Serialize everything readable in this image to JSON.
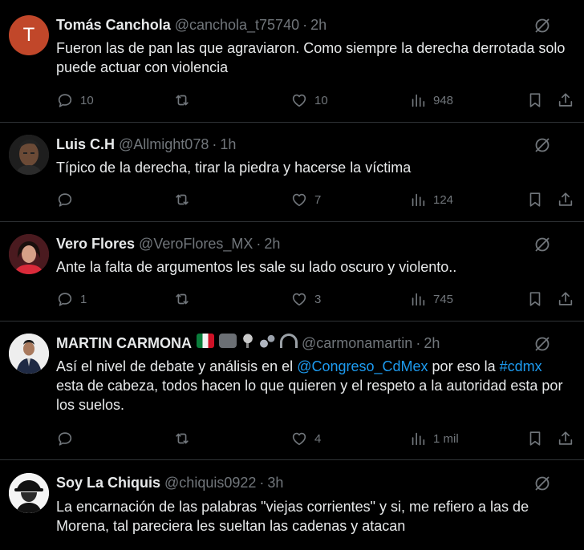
{
  "tweets": [
    {
      "name": "Tomás Canchola",
      "handle": "@canchola_t75740",
      "time": "2h",
      "avatar_letter": "T",
      "avatar_color": "#c1472a",
      "text": "Fueron las de pan las que agraviaron. Como siempre la derecha derrotada solo puede actuar con violencia",
      "replies": "10",
      "reposts": "",
      "likes": "10",
      "views": "948"
    },
    {
      "name": "Luis C.H",
      "handle": "@Allmight078",
      "time": "1h",
      "text": "Típico de la derecha, tirar la piedra y hacerse la víctima",
      "replies": "",
      "reposts": "",
      "likes": "7",
      "views": "124"
    },
    {
      "name": "Vero Flores",
      "handle": "@VeroFlores_MX",
      "time": "2h",
      "text": "Ante la falta de argumentos les sale su lado oscuro y violento..",
      "replies": "1",
      "reposts": "",
      "likes": "3",
      "views": "745"
    },
    {
      "name": "MARTIN CARMONA",
      "handle": "@carmonamartin",
      "time": "2h",
      "text_a": "Así el nivel de debate y análisis en el ",
      "mention": "@Congreso_CdMex",
      "text_b": " por eso la ",
      "hashtag": "#cdmx",
      "text_c": " esta de cabeza, todos hacen lo que quieren y el respeto a la autoridad esta por los suelos.",
      "replies": "",
      "reposts": "",
      "likes": "4",
      "views": "1 mil"
    },
    {
      "name": "Soy La Chiquis",
      "handle": "@chiquis0922",
      "time": "3h",
      "text": "La encarnación de las palabras \"viejas corrientes\" y si, me refiero a las de Morena, tal pareciera les sueltan las cadenas y atacan"
    }
  ],
  "separator": "·",
  "colors": {
    "background": "#000000",
    "text": "#e7e9ea",
    "muted": "#71767b",
    "link": "#1d9bf0",
    "divider": "#2f3336"
  },
  "icons": [
    "reply-icon",
    "repost-icon",
    "like-icon",
    "views-icon",
    "bookmark-icon",
    "share-icon",
    "grok-icon"
  ]
}
